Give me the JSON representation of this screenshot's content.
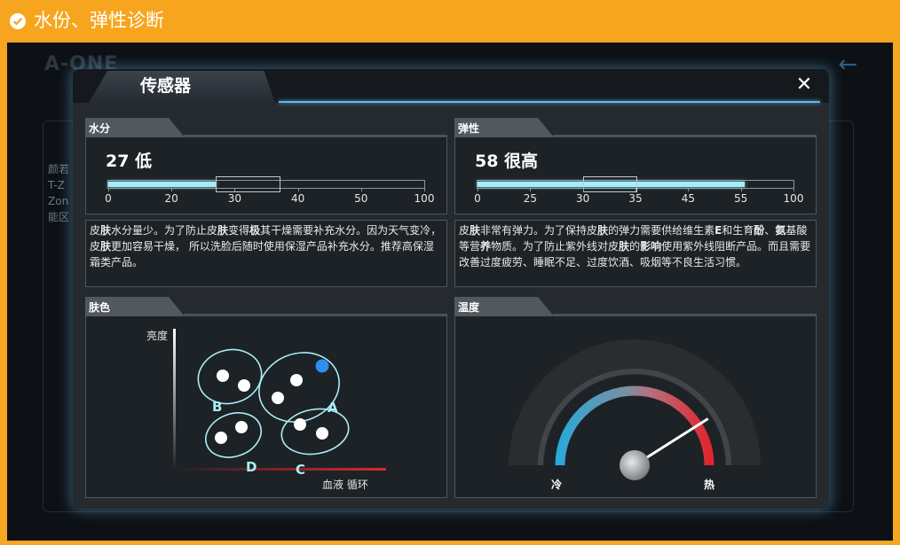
{
  "header": {
    "title": "水份、弹性诊断"
  },
  "background": {
    "logo": "A-ONE",
    "side_labels": [
      "颜若",
      "T-Z",
      "Zon",
      "能区"
    ],
    "back_arrow": "←"
  },
  "dialog": {
    "title": "传感器",
    "close": "✕"
  },
  "moisture": {
    "tab": "水分",
    "score": "27 低",
    "value": 27,
    "range": [
      0,
      100
    ],
    "box_range": [
      27,
      37
    ],
    "ticks": [
      "0",
      "20",
      "30",
      "40",
      "50",
      "100"
    ],
    "description_parts": [
      {
        "t": "皮",
        "b": false
      },
      {
        "t": "肤",
        "b": true
      },
      {
        "t": "水分量少。为了防止皮",
        "b": false
      },
      {
        "t": "肤",
        "b": true
      },
      {
        "t": "变得",
        "b": false
      },
      {
        "t": "极",
        "b": true
      },
      {
        "t": "其干燥需要补充水分。因为天气变冷，皮",
        "b": false
      },
      {
        "t": "肤",
        "b": true
      },
      {
        "t": "更加容易干燥， 所以洗脸后随时使用保湿产品补充水分。推荐高保湿霜类产品。",
        "b": false
      }
    ]
  },
  "elasticity": {
    "tab": "弹性",
    "score": "58 很高",
    "value": 58,
    "range": [
      0,
      100
    ],
    "box_range": [
      30,
      35
    ],
    "ticks": [
      "0",
      "25",
      "30",
      "35",
      "45",
      "55",
      "100"
    ],
    "description_parts": [
      {
        "t": "皮",
        "b": false
      },
      {
        "t": "肤",
        "b": true
      },
      {
        "t": "非常有弹力。为了保持皮",
        "b": false
      },
      {
        "t": "肤",
        "b": true
      },
      {
        "t": "的弹力需要供给维生素",
        "b": false
      },
      {
        "t": "E",
        "b": true
      },
      {
        "t": "和生育",
        "b": false
      },
      {
        "t": "酚",
        "b": true
      },
      {
        "t": "、",
        "b": false
      },
      {
        "t": "氨",
        "b": true
      },
      {
        "t": "基酸等营",
        "b": false
      },
      {
        "t": "养",
        "b": true
      },
      {
        "t": "物质。为了防止紫外线对皮",
        "b": false
      },
      {
        "t": "肤",
        "b": true
      },
      {
        "t": "的",
        "b": false
      },
      {
        "t": "影响",
        "b": true
      },
      {
        "t": "使用紫外线阻断产品。而且需要改善过度疲劳、睡眠不足、过度饮酒、吸烟等不良生活习惯。",
        "b": false
      }
    ]
  },
  "skin_color": {
    "tab": "肤色",
    "y_label": "亮度",
    "x_label": "血液 循环",
    "groups": [
      "A",
      "B",
      "C",
      "D"
    ],
    "selected_group": "A",
    "colors": {
      "ring": "#a9eef6",
      "dot": "#ffffff",
      "selected": "#2d8ff0"
    }
  },
  "temperature": {
    "tab": "温度",
    "cold": "冷",
    "hot": "热",
    "value": 0.82,
    "colors": {
      "cold": "#2ca8d8",
      "hot": "#e0262e"
    }
  }
}
